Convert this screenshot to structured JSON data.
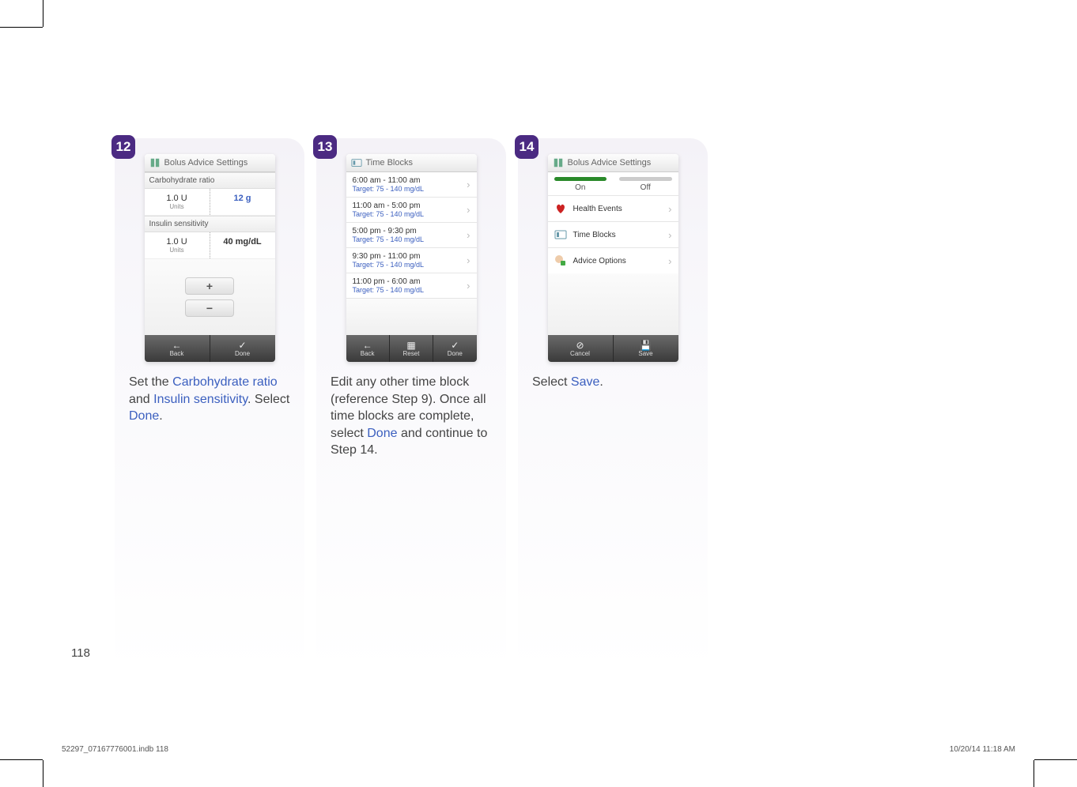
{
  "page_number": "118",
  "footer_left": "52297_07167776001.indb   118",
  "footer_right": "10/20/14   11:18 AM",
  "steps": {
    "s12": {
      "badge": "12",
      "header": "Bolus Advice Settings",
      "carb_label": "Carbohydrate ratio",
      "carb_left_val": "1.0 U",
      "carb_left_unit": "Units",
      "carb_right": "12 g",
      "ins_label": "Insulin sensitivity",
      "ins_left_val": "1.0 U",
      "ins_left_unit": "Units",
      "ins_right": "40 mg/dL",
      "back": "Back",
      "done": "Done",
      "caption_a": "Set the ",
      "caption_b": "Carbohydrate ratio",
      "caption_c": " and ",
      "caption_d": "Insulin sensitivity",
      "caption_e": ". Select ",
      "caption_f": "Done",
      "caption_g": "."
    },
    "s13": {
      "badge": "13",
      "header": "Time Blocks",
      "rows": [
        {
          "time": "6:00 am - 11:00 am",
          "target": "Target: 75 - 140 mg/dL"
        },
        {
          "time": "11:00 am - 5:00 pm",
          "target": "Target: 75 - 140 mg/dL"
        },
        {
          "time": "5:00 pm - 9:30 pm",
          "target": "Target: 75 - 140 mg/dL"
        },
        {
          "time": "9:30 pm - 11:00 pm",
          "target": "Target: 75 - 140 mg/dL"
        },
        {
          "time": "11:00 pm - 6:00 am",
          "target": "Target: 75 - 140 mg/dL"
        }
      ],
      "back": "Back",
      "reset": "Reset",
      "done": "Done",
      "caption_a": "Edit any other time block (reference Step 9). Once all time blocks are complete, select ",
      "caption_b": "Done",
      "caption_c": " and continue to Step 14."
    },
    "s14": {
      "badge": "14",
      "header": "Bolus Advice Settings",
      "on": "On",
      "off": "Off",
      "m1": "Health Events",
      "m2": "Time Blocks",
      "m3": "Advice Options",
      "cancel": "Cancel",
      "save": "Save",
      "caption_a": "Select ",
      "caption_b": "Save",
      "caption_c": "."
    }
  }
}
